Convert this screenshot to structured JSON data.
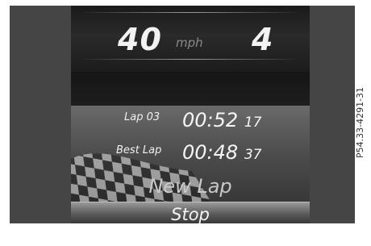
{
  "speed": {
    "value": "40",
    "unit": "mph"
  },
  "gear": "4",
  "laps": {
    "current": {
      "label": "Lap 03",
      "time_main": "00:52",
      "time_fraction": "17"
    },
    "best": {
      "label": "Best Lap",
      "time_main": "00:48",
      "time_fraction": "37"
    }
  },
  "buttons": {
    "new_lap": "New Lap",
    "stop": "Stop"
  },
  "image_code": "P54.33-4291-31"
}
